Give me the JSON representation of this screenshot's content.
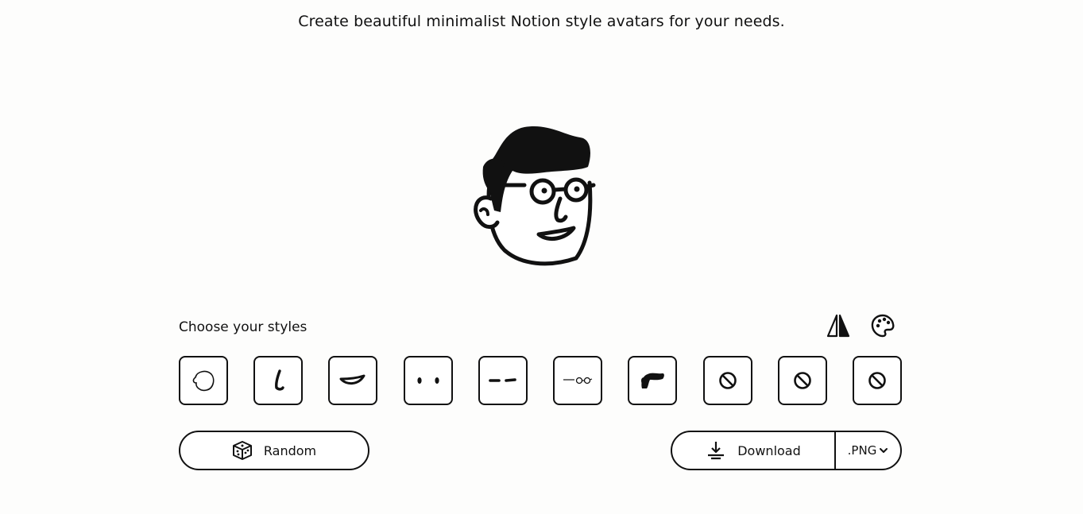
{
  "header": {
    "tagline": "Create beautiful minimalist Notion style avatars for your needs."
  },
  "avatar": {
    "description_icon": "avatar-preview"
  },
  "styles": {
    "label": "Choose your styles",
    "tools": [
      {
        "name": "flip-icon"
      },
      {
        "name": "palette-icon"
      }
    ],
    "tiles": [
      {
        "name": "face-style",
        "icon": "face-icon"
      },
      {
        "name": "nose-style",
        "icon": "nose-icon"
      },
      {
        "name": "mouth-style",
        "icon": "mouth-icon"
      },
      {
        "name": "eyes-style",
        "icon": "eyes-icon"
      },
      {
        "name": "eyebrows-style",
        "icon": "eyebrows-icon"
      },
      {
        "name": "glasses-style",
        "icon": "glasses-icon"
      },
      {
        "name": "hair-style",
        "icon": "hair-icon"
      },
      {
        "name": "accessory-style",
        "icon": "none-icon"
      },
      {
        "name": "details-style",
        "icon": "none-icon"
      },
      {
        "name": "beard-style",
        "icon": "none-icon"
      }
    ]
  },
  "actions": {
    "random_label": "Random",
    "download_label": "Download",
    "format_value": ".PNG"
  },
  "colors": {
    "ink": "#111111",
    "background": "#fdfdfc"
  }
}
